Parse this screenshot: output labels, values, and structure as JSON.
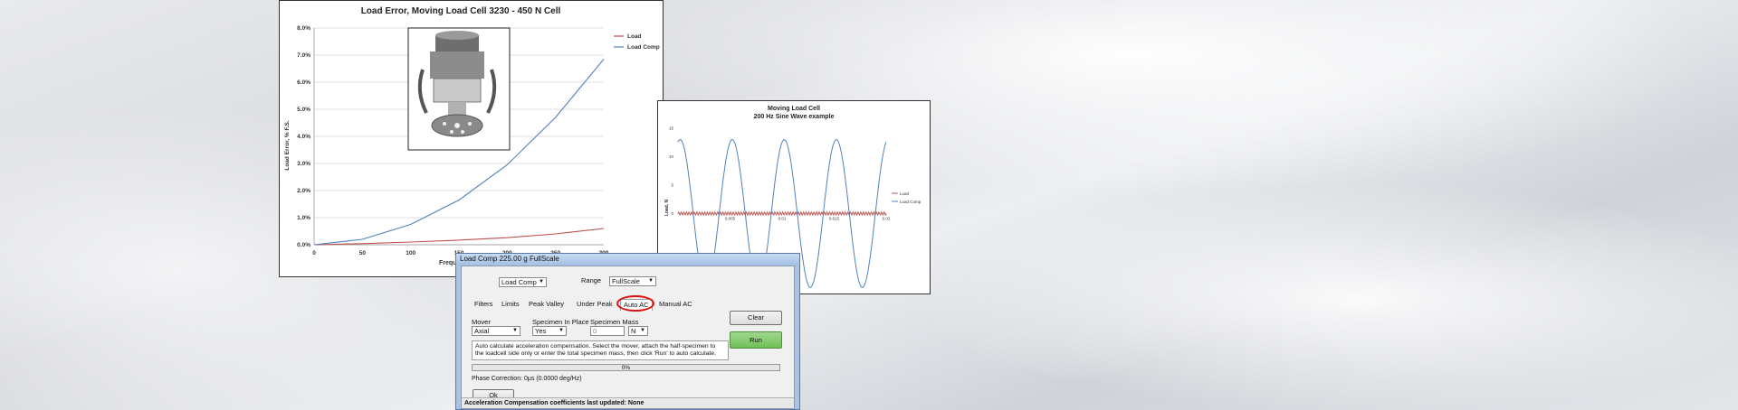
{
  "chart1": {
    "title": "Load Error, Moving Load Cell 3230 - 450 N Cell",
    "ylabel": "Load Error, % F.S.",
    "xlabel": "Frequ",
    "legend": [
      "Load",
      "Load Comp"
    ]
  },
  "chart2": {
    "title": "Moving Load Cell",
    "subtitle": "200 Hz Sine Wave example",
    "ylabel": "Load, N",
    "legend": [
      "Load",
      "Load Comp"
    ]
  },
  "colors": {
    "load": "#c0504d",
    "load_comp": "#4f81bd",
    "accent_circle": "#d11111"
  },
  "chart_data": [
    {
      "type": "line",
      "title": "Load Error, Moving Load Cell 3230 - 450 N Cell",
      "xlabel": "Frequ",
      "ylabel": "Load Error, % F.S.",
      "x": [
        0,
        50,
        100,
        150,
        200,
        250,
        300
      ],
      "xticks": [
        "0",
        "50",
        "100",
        "150",
        "200",
        "250",
        "300"
      ],
      "yticks": [
        "0.0%",
        "1.0%",
        "2.0%",
        "3.0%",
        "4.0%",
        "5.0%",
        "6.0%",
        "7.0%",
        "8.0%"
      ],
      "xlim": [
        0,
        300
      ],
      "ylim": [
        0,
        8
      ],
      "grid": true,
      "legend_position": "top-right",
      "series": [
        {
          "name": "Load",
          "values": [
            0,
            0.04,
            0.1,
            0.17,
            0.26,
            0.4,
            0.6
          ]
        },
        {
          "name": "Load Comp",
          "values": [
            0,
            0.2,
            0.75,
            1.65,
            2.95,
            4.7,
            6.85
          ]
        }
      ]
    },
    {
      "type": "line",
      "title": "Moving Load Cell",
      "subtitle": "200 Hz Sine Wave example",
      "ylabel": "Load, N",
      "xticks": [
        "0.005",
        "0.01",
        "0.015",
        "0.02"
      ],
      "yticks": [
        "15",
        "10",
        "5",
        "0"
      ],
      "xlim": [
        0,
        0.02
      ],
      "ylim": [
        -12,
        15
      ],
      "legend_position": "right",
      "series": [
        {
          "name": "Load",
          "amplitude": 0.3,
          "frequency_hz": 200
        },
        {
          "name": "Load Comp",
          "amplitude": 13,
          "frequency_hz": 200
        }
      ]
    }
  ],
  "dialog": {
    "title": "Load Comp  225.00 g FullScale",
    "mode_select": "Load Comp",
    "range_label": "Range",
    "range_select": "FullScale",
    "tabs": [
      "Filters",
      "Limits",
      "Peak Valley",
      "Under Peak",
      "Auto AC",
      "Manual AC"
    ],
    "mover_label": "Mover",
    "mover_value": "Axial",
    "specimen_in_place_label": "Specimen In Place",
    "specimen_in_place_value": "Yes",
    "specimen_mass_label": "Specimen Mass",
    "specimen_mass_value": "0",
    "unit_value": "N",
    "clear_label": "Clear",
    "run_label": "Run",
    "instructions": "Auto calculate acceleration compensation.  Select the mover, attach the half-specimen to the loadcell side only or enter the total specimen mass, then click 'Run' to auto calculate.",
    "progress_text": "0%",
    "phase_label": "Phase Correction: 0µs  (0.0000 deg/Hz)",
    "ok_label": "Ok",
    "status": "Acceleration Compensation coefficients last updated: None"
  }
}
